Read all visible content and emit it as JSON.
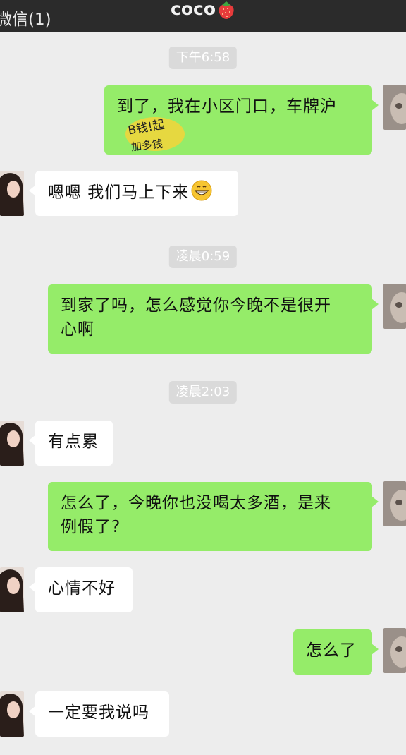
{
  "header": {
    "back_label": "微信(1)",
    "title": "coco",
    "title_emoji": "strawberry-icon"
  },
  "messages": [
    {
      "type": "time",
      "text": "下午6:58"
    },
    {
      "type": "out",
      "text": "到了，我在小区门口，车牌沪",
      "sticker_text": [
        "B钱!起",
        "加多钱"
      ]
    },
    {
      "type": "in",
      "text": "嗯嗯 我们马上下来",
      "emoji": "grinning-face-icon"
    },
    {
      "type": "time",
      "text": "凌晨0:59"
    },
    {
      "type": "out",
      "lines": [
        "到家了吗，怎么感觉你今晚不是很开",
        "心啊"
      ]
    },
    {
      "type": "time",
      "text": "凌晨2:03"
    },
    {
      "type": "in",
      "text": "有点累"
    },
    {
      "type": "out",
      "lines": [
        "怎么了，今晚你也没喝太多酒，是来",
        "例假了?"
      ]
    },
    {
      "type": "in",
      "text": "心情不好"
    },
    {
      "type": "out",
      "text": "怎么了"
    },
    {
      "type": "in",
      "text": "一定要我说吗"
    }
  ],
  "colors": {
    "background": "#ededed",
    "topbar": "#2b2b2b",
    "outgoing_bubble": "#95ec69",
    "incoming_bubble": "#ffffff",
    "timestamp_bg": "#dadada",
    "sticker_yellow": "#f5d53a"
  }
}
